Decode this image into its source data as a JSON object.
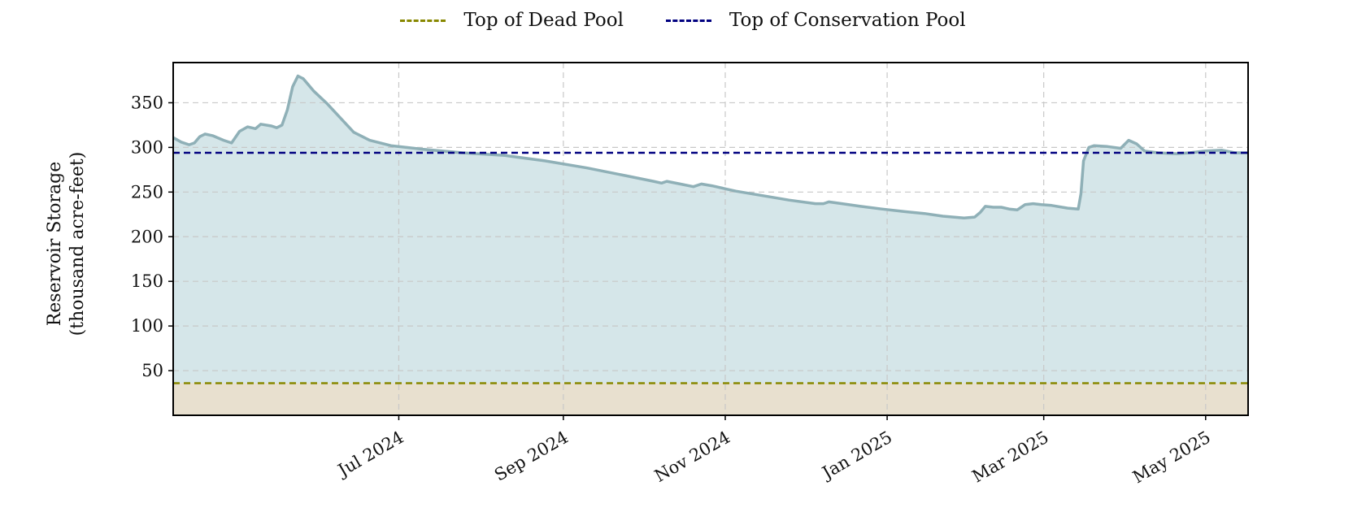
{
  "chart_data": {
    "type": "area",
    "title": "",
    "xlabel": "",
    "ylabel_lines": [
      "Reservoir Storage",
      "(thousand acre-feet)"
    ],
    "ylim": [
      0,
      395
    ],
    "xlim": [
      "2024-04-07",
      "2025-05-17"
    ],
    "y_ticks": [
      50,
      100,
      150,
      200,
      250,
      300,
      350
    ],
    "x_ticks": [
      {
        "date": "2024-07-01",
        "label": "Jul 2024"
      },
      {
        "date": "2024-09-01",
        "label": "Sep 2024"
      },
      {
        "date": "2024-11-01",
        "label": "Nov 2024"
      },
      {
        "date": "2025-01-01",
        "label": "Jan 2025"
      },
      {
        "date": "2025-03-01",
        "label": "Mar 2025"
      },
      {
        "date": "2025-05-01",
        "label": "May 2025"
      }
    ],
    "grid": true,
    "legend_position": "top-center",
    "reference_lines": [
      {
        "name": "Top of Dead Pool",
        "value": 36,
        "color": "#888800"
      },
      {
        "name": "Top of Conservation Pool",
        "value": 294,
        "color": "#000080"
      }
    ],
    "series": [
      {
        "color": "#8fb0b7",
        "fill": "#d5e6e9",
        "points": [
          [
            "2024-04-07",
            311
          ],
          [
            "2024-04-10",
            306
          ],
          [
            "2024-04-13",
            303
          ],
          [
            "2024-04-15",
            305
          ],
          [
            "2024-04-17",
            312
          ],
          [
            "2024-04-19",
            315
          ],
          [
            "2024-04-22",
            313
          ],
          [
            "2024-04-26",
            308
          ],
          [
            "2024-04-29",
            305
          ],
          [
            "2024-05-02",
            318
          ],
          [
            "2024-05-05",
            323
          ],
          [
            "2024-05-08",
            321
          ],
          [
            "2024-05-10",
            326
          ],
          [
            "2024-05-14",
            324
          ],
          [
            "2024-05-16",
            322
          ],
          [
            "2024-05-18",
            325
          ],
          [
            "2024-05-20",
            342
          ],
          [
            "2024-05-22",
            368
          ],
          [
            "2024-05-24",
            380
          ],
          [
            "2024-05-26",
            377
          ],
          [
            "2024-05-30",
            363
          ],
          [
            "2024-06-04",
            349
          ],
          [
            "2024-06-09",
            333
          ],
          [
            "2024-06-14",
            317
          ],
          [
            "2024-06-20",
            308
          ],
          [
            "2024-06-28",
            302
          ],
          [
            "2024-07-10",
            298
          ],
          [
            "2024-07-25",
            294
          ],
          [
            "2024-08-10",
            291
          ],
          [
            "2024-08-25",
            285
          ],
          [
            "2024-09-10",
            277
          ],
          [
            "2024-09-25",
            268
          ],
          [
            "2024-10-05",
            262
          ],
          [
            "2024-10-08",
            260
          ],
          [
            "2024-10-10",
            262
          ],
          [
            "2024-10-15",
            259
          ],
          [
            "2024-10-20",
            256
          ],
          [
            "2024-10-23",
            259
          ],
          [
            "2024-10-27",
            257
          ],
          [
            "2024-11-05",
            251
          ],
          [
            "2024-11-15",
            246
          ],
          [
            "2024-11-25",
            241
          ],
          [
            "2024-12-05",
            237
          ],
          [
            "2024-12-08",
            237
          ],
          [
            "2024-12-10",
            239
          ],
          [
            "2024-12-15",
            237
          ],
          [
            "2024-12-22",
            234
          ],
          [
            "2024-12-30",
            231
          ],
          [
            "2025-01-08",
            228
          ],
          [
            "2025-01-15",
            226
          ],
          [
            "2025-01-22",
            223
          ],
          [
            "2025-01-30",
            221
          ],
          [
            "2025-02-03",
            222
          ],
          [
            "2025-02-05",
            227
          ],
          [
            "2025-02-07",
            234
          ],
          [
            "2025-02-10",
            233
          ],
          [
            "2025-02-13",
            233
          ],
          [
            "2025-02-16",
            231
          ],
          [
            "2025-02-19",
            230
          ],
          [
            "2025-02-22",
            236
          ],
          [
            "2025-02-25",
            237
          ],
          [
            "2025-02-28",
            236
          ],
          [
            "2025-03-04",
            235
          ],
          [
            "2025-03-10",
            232
          ],
          [
            "2025-03-14",
            231
          ],
          [
            "2025-03-15",
            248
          ],
          [
            "2025-03-16",
            285
          ],
          [
            "2025-03-18",
            300
          ],
          [
            "2025-03-20",
            302
          ],
          [
            "2025-03-25",
            301
          ],
          [
            "2025-03-30",
            299
          ],
          [
            "2025-04-02",
            308
          ],
          [
            "2025-04-05",
            304
          ],
          [
            "2025-04-08",
            296
          ],
          [
            "2025-04-13",
            294
          ],
          [
            "2025-04-20",
            293
          ],
          [
            "2025-04-25",
            294
          ],
          [
            "2025-05-01",
            296
          ],
          [
            "2025-05-07",
            297
          ],
          [
            "2025-05-12",
            294
          ],
          [
            "2025-05-17",
            294
          ]
        ]
      }
    ]
  }
}
